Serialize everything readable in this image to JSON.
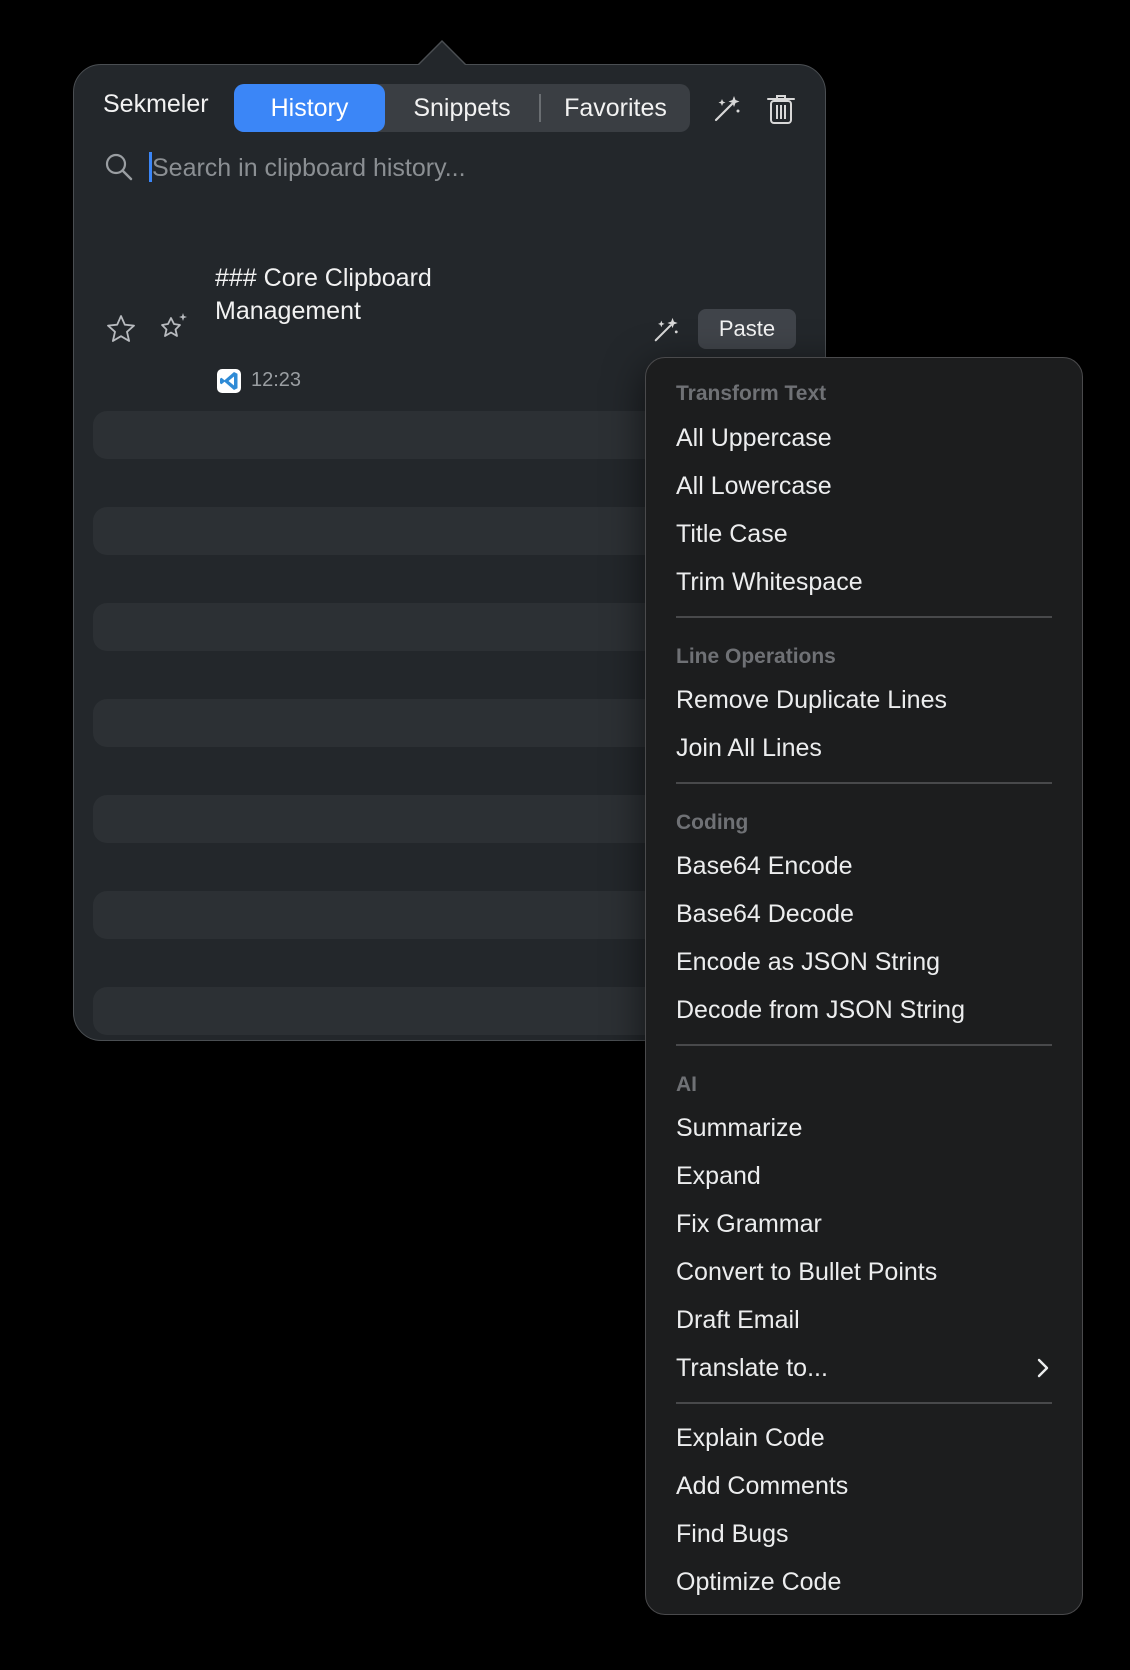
{
  "app": {
    "name": "Sekmeler"
  },
  "tabs": [
    {
      "label": "History",
      "active": true
    },
    {
      "label": "Snippets",
      "active": false
    },
    {
      "label": "Favorites",
      "active": false
    }
  ],
  "toolbar": {
    "magic_icon": "magic-wand-icon",
    "trash_icon": "trash-icon"
  },
  "search": {
    "placeholder": "Search in clipboard history...",
    "value": ""
  },
  "clip_item": {
    "title": "### Core Clipboard Management",
    "time": "12:23",
    "source_app_icon": "vscode-icon",
    "paste_label": "Paste"
  },
  "colors": {
    "accent": "#3b86f7",
    "panel": "#23272b",
    "menu": "#1c1d1e"
  },
  "menu": {
    "sections": [
      {
        "header": "Transform Text",
        "items": [
          "All Uppercase",
          "All Lowercase",
          "Title Case",
          "Trim Whitespace"
        ]
      },
      {
        "header": "Line Operations",
        "items": [
          "Remove Duplicate Lines",
          "Join All Lines"
        ]
      },
      {
        "header": "Coding",
        "items": [
          "Base64 Encode",
          "Base64 Decode",
          "Encode as JSON String",
          "Decode from JSON String"
        ]
      },
      {
        "header": "AI",
        "items": [
          "Summarize",
          "Expand",
          "Fix Grammar",
          "Convert to Bullet Points",
          "Draft Email",
          "Translate to..."
        ]
      },
      {
        "header": "",
        "items": [
          "Explain Code",
          "Add Comments",
          "Find Bugs",
          "Optimize Code"
        ]
      }
    ]
  }
}
